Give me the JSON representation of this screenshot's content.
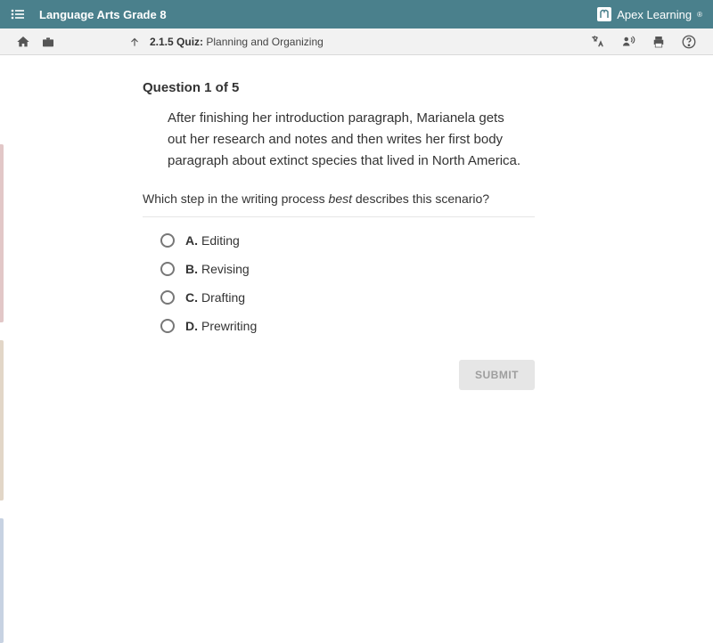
{
  "header": {
    "course_title": "Language Arts Grade 8",
    "brand": "Apex Learning"
  },
  "breadcrumb": {
    "number": "2.1.5",
    "type": "Quiz:",
    "title": "Planning and Organizing"
  },
  "question": {
    "counter": "Question 1 of 5",
    "passage": "After finishing her introduction paragraph, Marianela gets out her research and notes and then writes her first body paragraph about extinct species that lived in North America.",
    "prompt_pre": "Which step in the writing process ",
    "prompt_em": "best",
    "prompt_post": " describes this scenario?",
    "choices": [
      {
        "letter": "A.",
        "text": "Editing"
      },
      {
        "letter": "B.",
        "text": "Revising"
      },
      {
        "letter": "C.",
        "text": "Drafting"
      },
      {
        "letter": "D.",
        "text": "Prewriting"
      }
    ],
    "submit_label": "SUBMIT"
  }
}
